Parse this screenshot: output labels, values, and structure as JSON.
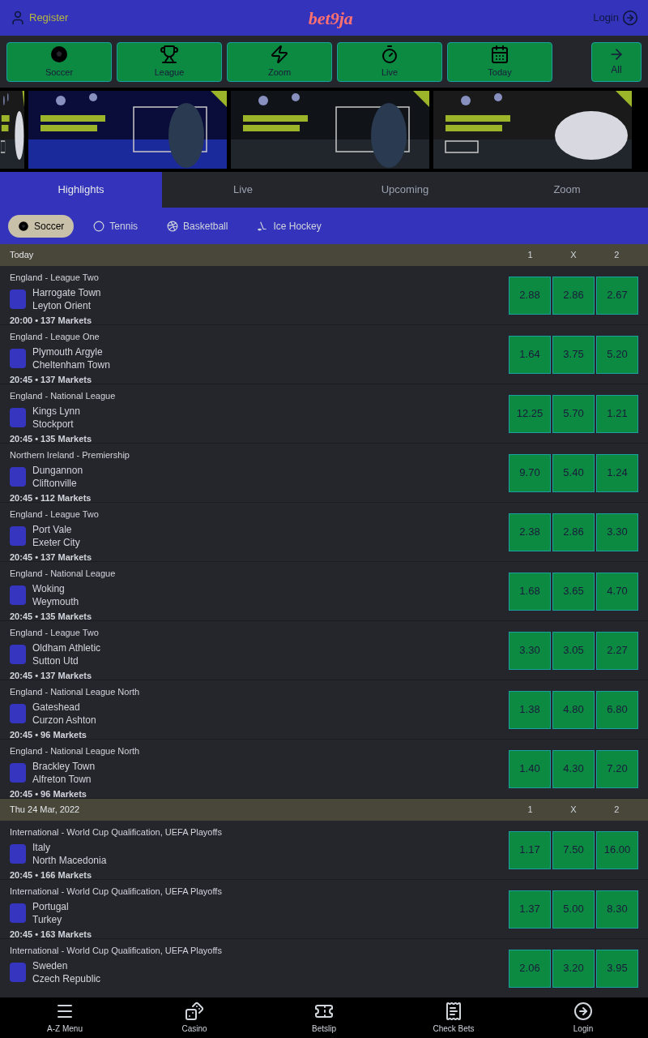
{
  "header": {
    "register": "Register",
    "logo": "bet9ja",
    "login": "Login"
  },
  "quick_links": [
    {
      "label": "Soccer",
      "kind": "soccer"
    },
    {
      "label": "League",
      "kind": "league"
    },
    {
      "label": "Zoom",
      "kind": "zoom"
    },
    {
      "label": "Live",
      "kind": "live"
    },
    {
      "label": "Today",
      "kind": "today"
    }
  ],
  "all_link": "All",
  "tabs": [
    {
      "label": "Highlights",
      "selected": true
    },
    {
      "label": "Live",
      "selected": false
    },
    {
      "label": "Upcoming",
      "selected": false
    },
    {
      "label": "Zoom",
      "selected": false
    }
  ],
  "sports": [
    {
      "label": "Soccer",
      "kind": "soccer",
      "selected": true
    },
    {
      "label": "Tennis",
      "kind": "tennis",
      "selected": false
    },
    {
      "label": "Basketball",
      "kind": "basketball",
      "selected": false
    },
    {
      "label": "Ice Hockey",
      "kind": "hockey",
      "selected": false
    }
  ],
  "sections": [
    {
      "title": "Today",
      "columns": [
        "1",
        "X",
        "2"
      ],
      "matches": [
        {
          "league": "England - League Two",
          "home": "Harrogate Town",
          "away": "Leyton Orient",
          "info": "20:00 • 137 Markets",
          "odds": [
            "2.88",
            "2.86",
            "2.67"
          ]
        },
        {
          "league": "England - League One",
          "home": "Plymouth Argyle",
          "away": "Cheltenham Town",
          "info": "20:45 • 137 Markets",
          "odds": [
            "1.64",
            "3.75",
            "5.20"
          ]
        },
        {
          "league": "England - National League",
          "home": "Kings Lynn",
          "away": "Stockport",
          "info": "20:45 • 135 Markets",
          "odds": [
            "12.25",
            "5.70",
            "1.21"
          ]
        },
        {
          "league": "Northern Ireland - Premiership",
          "home": "Dungannon",
          "away": "Cliftonville",
          "info": "20:45 • 112 Markets",
          "odds": [
            "9.70",
            "5.40",
            "1.24"
          ]
        },
        {
          "league": "England - League Two",
          "home": "Port Vale",
          "away": "Exeter City",
          "info": "20:45 • 137 Markets",
          "odds": [
            "2.38",
            "2.86",
            "3.30"
          ]
        },
        {
          "league": "England - National League",
          "home": "Woking",
          "away": "Weymouth",
          "info": "20:45 • 135 Markets",
          "odds": [
            "1.68",
            "3.65",
            "4.70"
          ]
        },
        {
          "league": "England - League Two",
          "home": "Oldham Athletic",
          "away": "Sutton Utd",
          "info": "20:45 • 137 Markets",
          "odds": [
            "3.30",
            "3.05",
            "2.27"
          ]
        },
        {
          "league": "England - National League North",
          "home": "Gateshead",
          "away": "Curzon Ashton",
          "info": "20:45 • 96 Markets",
          "odds": [
            "1.38",
            "4.80",
            "6.80"
          ]
        },
        {
          "league": "England - National League North",
          "home": "Brackley Town",
          "away": "Alfreton Town",
          "info": "20:45 • 96 Markets",
          "odds": [
            "1.40",
            "4.30",
            "7.20"
          ]
        }
      ]
    },
    {
      "title": "Thu 24 Mar, 2022",
      "columns": [
        "1",
        "X",
        "2"
      ],
      "matches": [
        {
          "league": "International - World Cup Qualification, UEFA Playoffs",
          "home": "Italy",
          "away": "North Macedonia",
          "info": "20:45 • 166 Markets",
          "odds": [
            "1.17",
            "7.50",
            "16.00"
          ]
        },
        {
          "league": "International - World Cup Qualification, UEFA Playoffs",
          "home": "Portugal",
          "away": "Turkey",
          "info": "20:45 • 163 Markets",
          "odds": [
            "1.37",
            "5.00",
            "8.30"
          ]
        },
        {
          "league": "International - World Cup Qualification, UEFA Playoffs",
          "home": "Sweden",
          "away": "Czech Republic",
          "odds": [
            "2.06",
            "3.20",
            "3.95"
          ]
        }
      ]
    }
  ],
  "bottom_nav": [
    {
      "label": "A-Z Menu",
      "kind": "menu"
    },
    {
      "label": "Casino",
      "kind": "casino"
    },
    {
      "label": "Betslip",
      "kind": "betslip"
    },
    {
      "label": "Check Bets",
      "kind": "check"
    },
    {
      "label": "Login",
      "kind": "login"
    }
  ]
}
